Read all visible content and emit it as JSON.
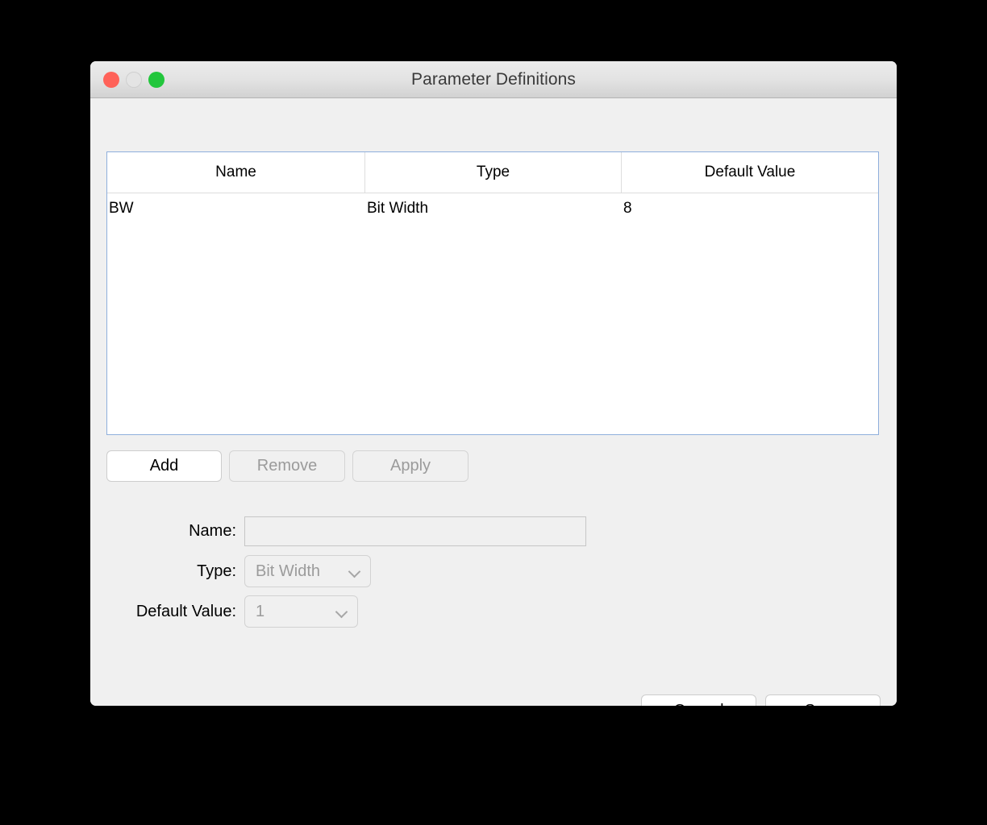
{
  "window": {
    "title": "Parameter Definitions",
    "traffic_lights": [
      {
        "name": "close",
        "color": "#ff6259"
      },
      {
        "name": "minimize",
        "color": "#e4e4e4"
      },
      {
        "name": "maximize",
        "color": "#22c63c"
      }
    ],
    "border_accent": "#8fafdc",
    "background": "#f0f0f0"
  },
  "table": {
    "columns": [
      "Name",
      "Type",
      "Default Value"
    ],
    "rows": [
      {
        "name": "BW",
        "type": "Bit Width",
        "default_value": "8"
      }
    ]
  },
  "actions": {
    "add_label": "Add",
    "remove_label": "Remove",
    "apply_label": "Apply",
    "add_enabled": true,
    "remove_enabled": false,
    "apply_enabled": false
  },
  "form": {
    "name_label": "Name:",
    "name_value": "",
    "name_placeholder": "",
    "type_label": "Type:",
    "type_value": "Bit Width",
    "default_value_label": "Default Value:",
    "default_value_value": "1"
  },
  "footer": {
    "cancel_label": "Cancel",
    "save_label": "Save"
  }
}
